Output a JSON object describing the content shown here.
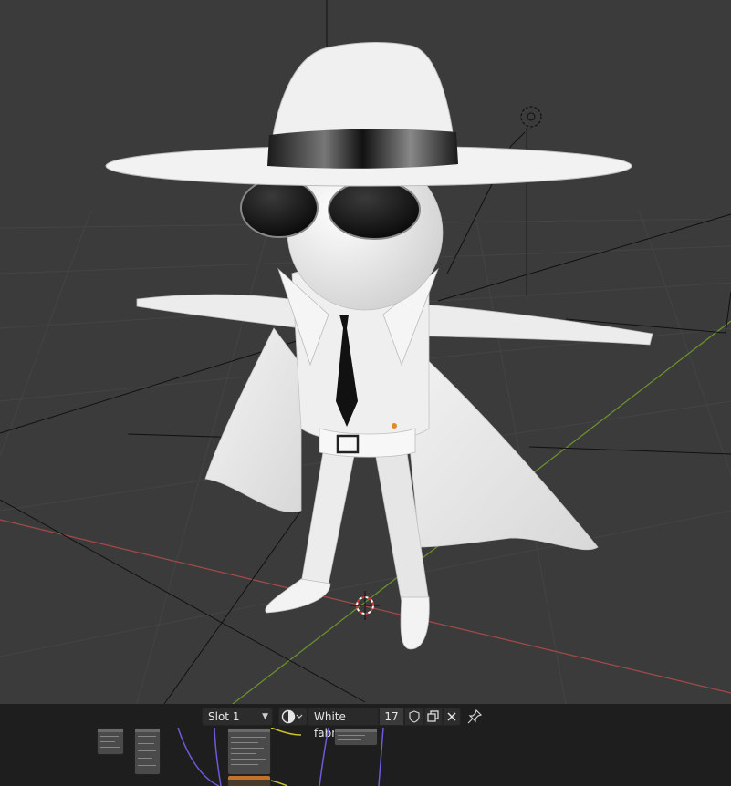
{
  "viewport": {
    "scene_description_icon": "character-mesh",
    "cursor_icon": "3d-cursor-icon",
    "colors": {
      "background": "#3b3b3b",
      "grid": "#444444",
      "x_axis": "#a34a4a",
      "y_axis": "#6b8f2e"
    }
  },
  "node_editor": {
    "slot_selector": {
      "value": "Slot 1"
    },
    "shader_type_icon": "material-sphere-icon",
    "material": {
      "name": "White fabric",
      "users": "17"
    },
    "fake_user_icon": "shield-icon",
    "duplicate_icon": "duplicate-icon",
    "unlink_icon": "close-icon",
    "pin_icon": "pin-icon"
  }
}
